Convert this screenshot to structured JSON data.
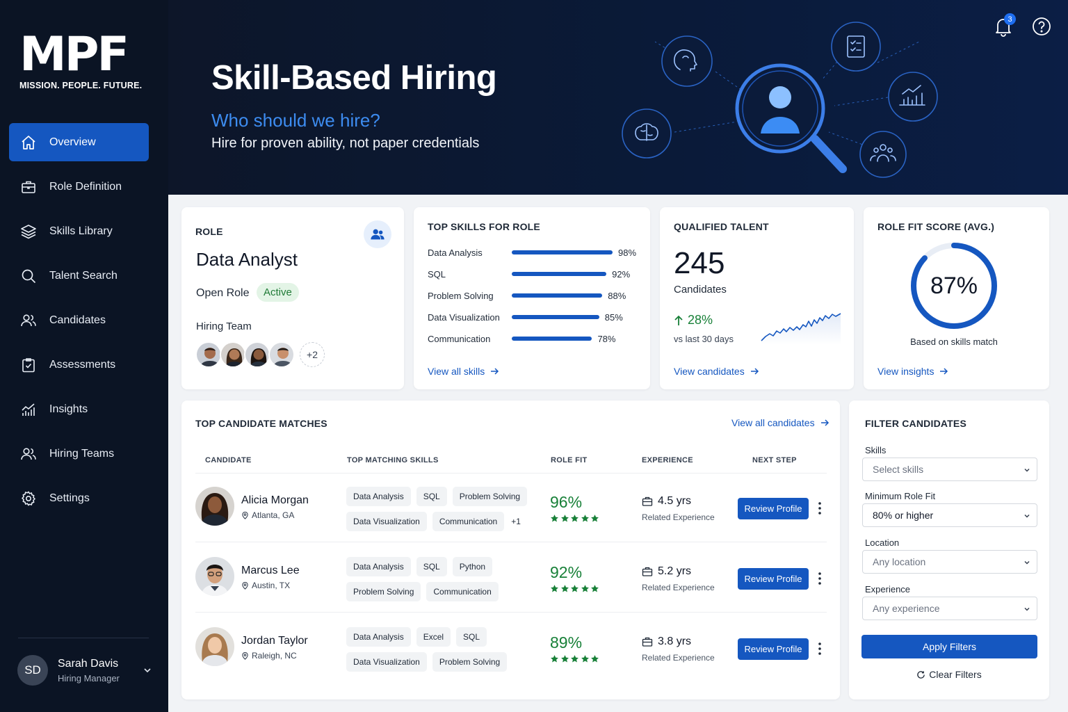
{
  "brand": {
    "mark": "MPF",
    "tagline": "MISSION. PEOPLE. FUTURE."
  },
  "nav": [
    {
      "label": "Overview",
      "icon": "home-icon",
      "active": true
    },
    {
      "label": "Role Definition",
      "icon": "briefcase-icon"
    },
    {
      "label": "Skills Library",
      "icon": "layers-icon"
    },
    {
      "label": "Talent Search",
      "icon": "search-icon"
    },
    {
      "label": "Candidates",
      "icon": "users-icon"
    },
    {
      "label": "Assessments",
      "icon": "clipboard-check-icon"
    },
    {
      "label": "Insights",
      "icon": "bar-chart-icon"
    },
    {
      "label": "Hiring Teams",
      "icon": "team-icon"
    },
    {
      "label": "Settings",
      "icon": "gear-icon"
    }
  ],
  "user": {
    "initials": "SD",
    "name": "Sarah Davis",
    "role": "Hiring Manager"
  },
  "hero": {
    "title": "Skill-Based Hiring",
    "subtitle": "Who should we hire?",
    "description": "Hire for proven ability, not paper credentials",
    "notifications": "3",
    "accent": "#3d8cf0"
  },
  "role": {
    "heading": "ROLE",
    "title": "Data Analyst",
    "status_label": "Open Role",
    "status": "Active",
    "team_label": "Hiring Team",
    "team_more": "+2"
  },
  "top_skills": {
    "heading": "TOP SKILLS FOR ROLE",
    "items": [
      {
        "name": "Data Analysis",
        "pct": "98%",
        "value": 98
      },
      {
        "name": "SQL",
        "pct": "92%",
        "value": 92
      },
      {
        "name": "Problem Solving",
        "pct": "88%",
        "value": 88
      },
      {
        "name": "Data Visualization",
        "pct": "85%",
        "value": 85
      },
      {
        "name": "Communication",
        "pct": "78%",
        "value": 78
      }
    ],
    "link": "View all skills"
  },
  "talent": {
    "heading": "QUALIFIED TALENT",
    "count": "245",
    "label": "Candidates",
    "trend": "28%",
    "trend_note": "vs last 30 days",
    "link": "View candidates"
  },
  "fit": {
    "heading": "ROLE FIT SCORE (AVG.)",
    "value": "87%",
    "fraction": 0.87,
    "basis": "Based on skills match",
    "link": "View insights"
  },
  "matches": {
    "heading": "TOP CANDIDATE MATCHES",
    "link": "View all candidates",
    "columns": [
      "CANDIDATE",
      "TOP MATCHING SKILLS",
      "ROLE FIT",
      "EXPERIENCE",
      "NEXT STEP"
    ],
    "rows": [
      {
        "name": "Alicia Morgan",
        "location": "Atlanta, GA",
        "skills1": [
          "Data Analysis",
          "SQL",
          "Problem Solving"
        ],
        "skills2": [
          "Data Visualization",
          "Communication"
        ],
        "more": "+1",
        "fit": "96%",
        "stars": 5,
        "experience": "4.5 yrs",
        "exp_label": "Related Experience",
        "action": "Review Profile"
      },
      {
        "name": "Marcus Lee",
        "location": "Austin, TX",
        "skills1": [
          "Data Analysis",
          "SQL",
          "Python"
        ],
        "skills2": [
          "Problem Solving",
          "Communication"
        ],
        "more": "",
        "fit": "92%",
        "stars": 5,
        "experience": "5.2 yrs",
        "exp_label": "Related Experience",
        "action": "Review Profile"
      },
      {
        "name": "Jordan Taylor",
        "location": "Raleigh, NC",
        "skills1": [
          "Data Analysis",
          "Excel",
          "SQL"
        ],
        "skills2": [
          "Data Visualization",
          "Problem Solving"
        ],
        "more": "",
        "fit": "89%",
        "stars": 5,
        "experience": "3.8 yrs",
        "exp_label": "Related Experience",
        "action": "Review Profile"
      }
    ]
  },
  "filter": {
    "heading": "FILTER CANDIDATES",
    "skills_label": "Skills",
    "skills_placeholder": "Select skills",
    "fit_label": "Minimum Role Fit",
    "fit_value": "80% or higher",
    "location_label": "Location",
    "location_placeholder": "Any location",
    "experience_label": "Experience",
    "experience_placeholder": "Any experience",
    "apply": "Apply Filters",
    "clear": "Clear Filters"
  },
  "colors": {
    "primary": "#1557c0",
    "success": "#188038",
    "sidebar": "#0b1424"
  }
}
